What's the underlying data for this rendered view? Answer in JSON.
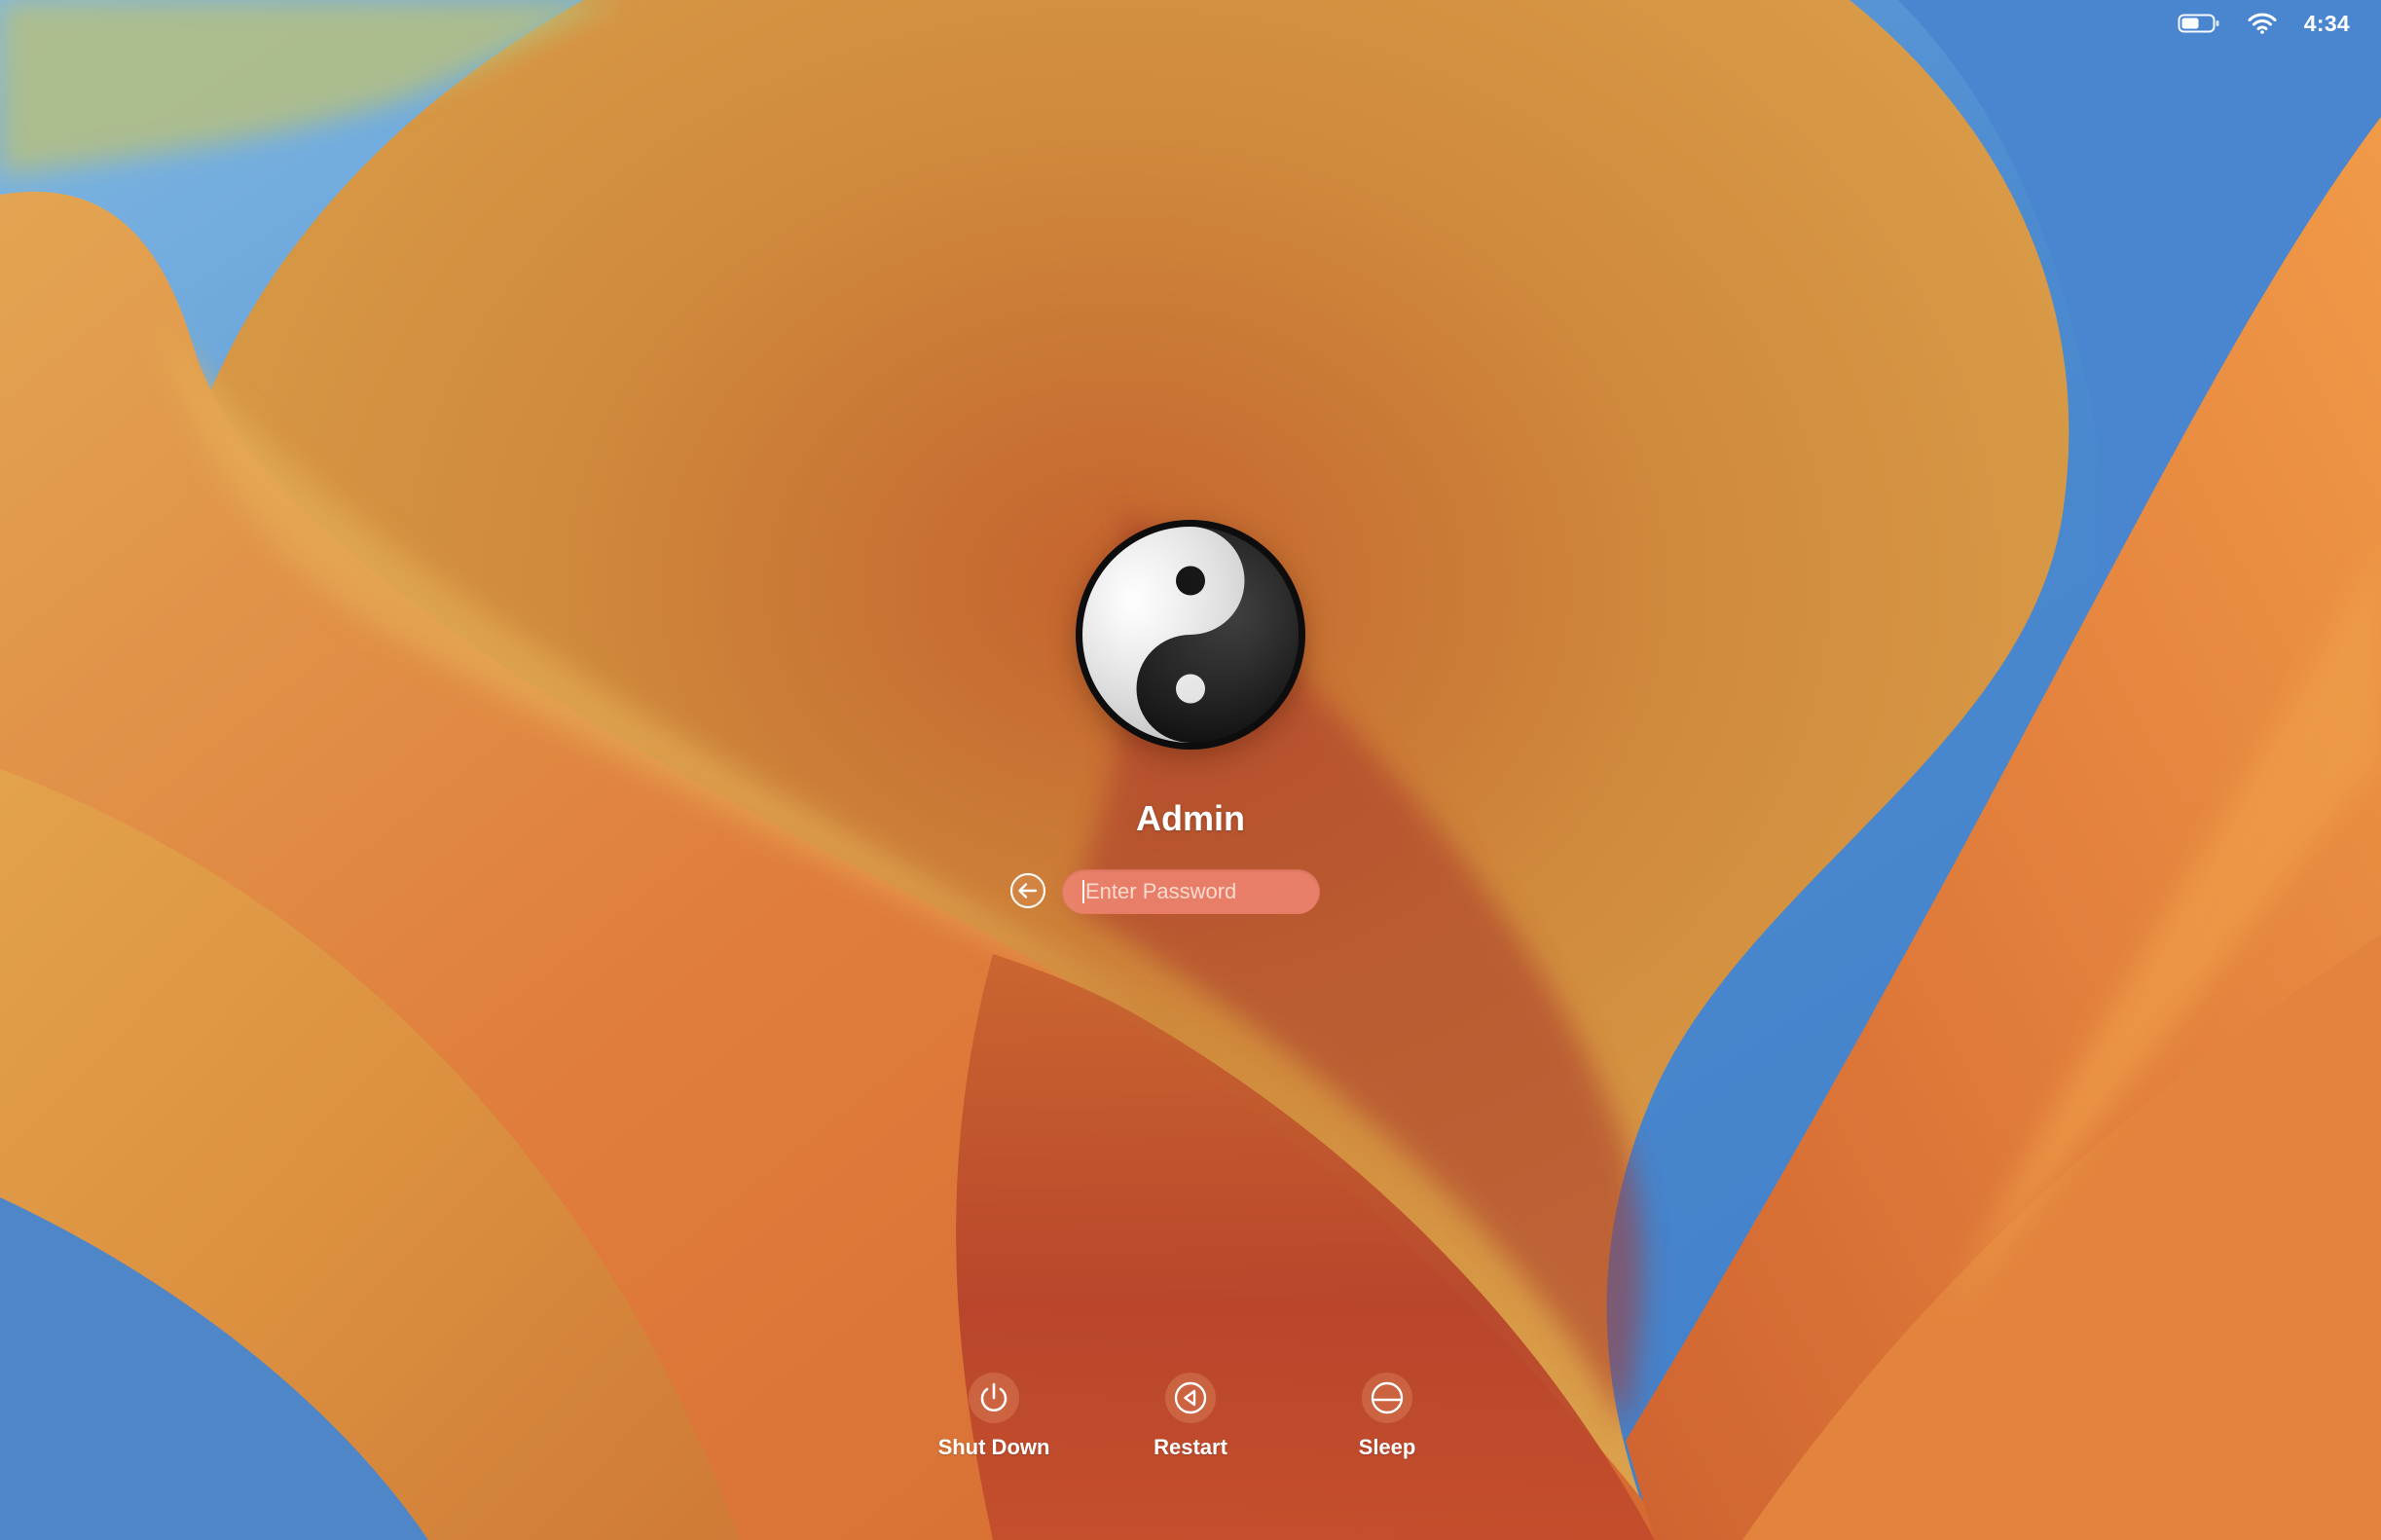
{
  "status_bar": {
    "battery_icon": "battery-icon",
    "wifi_icon": "wifi-icon",
    "time": "4:34"
  },
  "login": {
    "avatar_icon": "yin-yang-avatar",
    "user_name": "Admin",
    "back_icon": "back-arrow-icon",
    "password": {
      "value": "",
      "placeholder": "Enter Password"
    }
  },
  "actions": [
    {
      "label": "Shut Down",
      "icon": "power-icon"
    },
    {
      "label": "Restart",
      "icon": "restart-icon"
    },
    {
      "label": "Sleep",
      "icon": "sleep-icon"
    }
  ],
  "colors": {
    "sky_blue": "#4f8ed0",
    "petal_orange": "#e0873e",
    "petal_yellow": "#e3b358",
    "deep_red": "#b6402a",
    "password_field": "#ee8470"
  }
}
